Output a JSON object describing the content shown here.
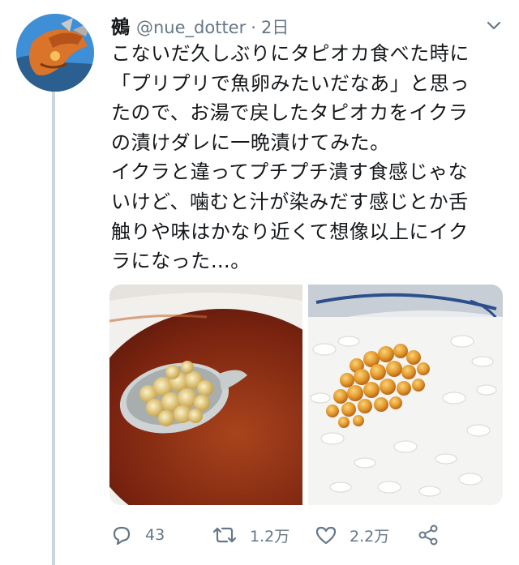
{
  "tweet": {
    "author_name": "鵺",
    "handle": "@nue_dotter",
    "separator": "·",
    "time": "2日",
    "text_lines": [
      "こないだ久しぶりにタピオカ食べた時に",
      "「プリプリで魚卵みたいだなあ」と思っ",
      "たので、お湯で戻したタピオカをイクラ",
      "の漬けダレに一晩漬けてみた。",
      "イクラと違ってプチプチ潰す食感じゃな",
      "いけど、噛むと汁が染みだす感じとか舌",
      "触りや味はかなり近くて想像以上にイク",
      "ラになった…。"
    ],
    "media": [
      {
        "subject": "tapioca pearls on a spoon in dark marinade"
      },
      {
        "subject": "marinated tapioca pearls on white rice"
      }
    ]
  },
  "actions": {
    "reply_count": "43",
    "retweet_count": "1.2万",
    "like_count": "2.2万"
  },
  "colors": {
    "text": "#14171a",
    "secondary": "#657786",
    "thread_line": "#ccd6dd",
    "icon": "#657786"
  },
  "icons": [
    "reply-icon",
    "retweet-icon",
    "like-icon",
    "share-icon",
    "chevron-down-icon"
  ]
}
